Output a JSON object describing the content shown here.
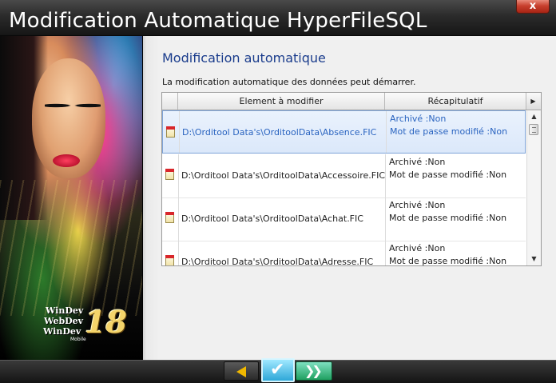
{
  "window": {
    "title": "Modification Automatique HyperFileSQL",
    "close_label": "x"
  },
  "branding": {
    "products": [
      "WinDev",
      "WebDev",
      "WinDev"
    ],
    "mobile_label": "Mobile",
    "version": "18"
  },
  "main": {
    "heading": "Modification automatique",
    "intro": "La modification automatique des données peut démarrer."
  },
  "table": {
    "columns": [
      "Element à modifier",
      "Récapitulatif"
    ],
    "rows": [
      {
        "path": "D:\\Orditool Data's\\OrditoolData\\Absence.FIC",
        "archive": "Archivé :Non",
        "password": "Mot de passe modifié :Non"
      },
      {
        "path": "D:\\Orditool Data's\\OrditoolData\\Accessoire.FIC",
        "archive": "Archivé :Non",
        "password": "Mot de passe modifié :Non"
      },
      {
        "path": "D:\\Orditool Data's\\OrditoolData\\Achat.FIC",
        "archive": "Archivé :Non",
        "password": "Mot de passe modifié :Non"
      },
      {
        "path": "D:\\Orditool Data's\\OrditoolData\\Adresse.FIC",
        "archive": "Archivé :Non",
        "password": "Mot de passe modifié :Non"
      }
    ],
    "selected_row": 0
  },
  "icons": {
    "close": "close-icon",
    "back": "arrow-left-icon",
    "ok": "checkmark-icon",
    "next": "double-arrow-right-icon",
    "file": "file-icon"
  },
  "colors": {
    "heading": "#1a3c8c",
    "selected_text": "#2a64c0",
    "close_button": "#c9402e"
  }
}
